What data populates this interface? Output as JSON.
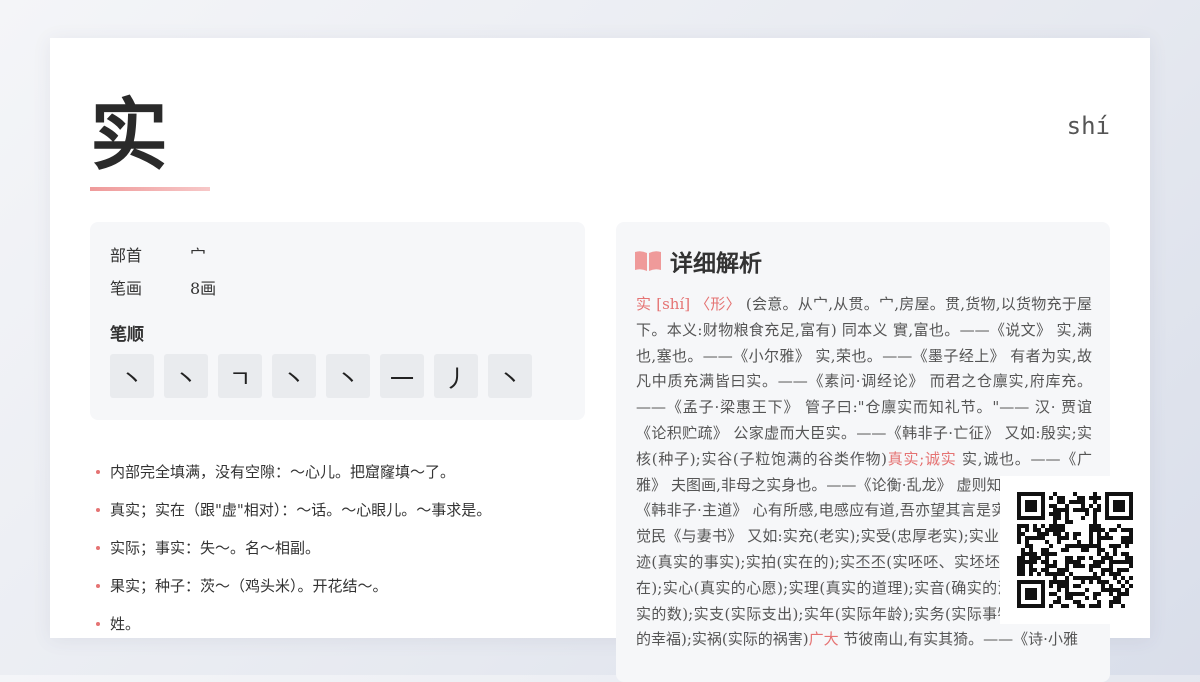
{
  "character": "实",
  "pinyin": "shí",
  "info": {
    "radical_label": "部首",
    "radical_value": "宀",
    "strokes_label": "笔画",
    "strokes_value": "8画",
    "stroke_order_title": "笔顺",
    "stroke_order": [
      "丶",
      "丶",
      "ㄱ",
      "丶",
      "丶",
      "一",
      "丿",
      "丶"
    ]
  },
  "definitions": [
    "内部完全填满，没有空隙：～心儿。把窟窿填～了。",
    "真实；实在（跟\"虚\"相对）：～话。～心眼儿。～事求是。",
    "实际；事实：失～。名～相副。",
    "果实；种子：茨～（鸡头米）。开花结～。",
    "姓。"
  ],
  "detail": {
    "title": "详细解析",
    "head": "实 [shí] 〈形〉",
    "p1": "(会意。从宀,从贯。宀,房屋。贯,货物,以货物充于屋下。本义:财物粮食充足,富有) 同本义 實,富也。——《说文》 实,满也,塞也。——《小尔雅》 实,荣也。——《墨子经上》 有者为实,故凡中质充满皆曰实。——《素问·调经论》 而君之仓廪实,府库充。——《孟子·梁惠王下》 管子曰:\"仓廪实而知礼节。\"—— 汉· 贾谊《论积贮疏》 公家虚而大臣实。——《韩非子·亡征》 又如:殷实;实核(种子);实谷(子粒饱满的谷类作物)",
    "hl1": "真实;诚实",
    "p2": " 实,诚也。——《广雅》 夫图画,非母之实身也。——《论衡·乱龙》 虚则知实之情。——《韩非子·主道》 心有所感,电感应有道,吾亦望其言是实。——清· 林觉民《与妻书》 又如:实充(老实);实受(忠厚老实);实业(实际业绩);实迹(真实的事实);实拍(实在的);实丕丕(实呸呸、实坯坯。都指实实在在);实心(真实的心愿);实理(真实的道理);实音(确实的消息);实数(真实的数);实支(实际支出);实年(实际年龄);实务(实际事物);实福(实际的幸福);实祸(实际的祸害)",
    "hl2": "广大",
    "p3": " 节彼南山,有实其猗。——《诗·小雅"
  }
}
